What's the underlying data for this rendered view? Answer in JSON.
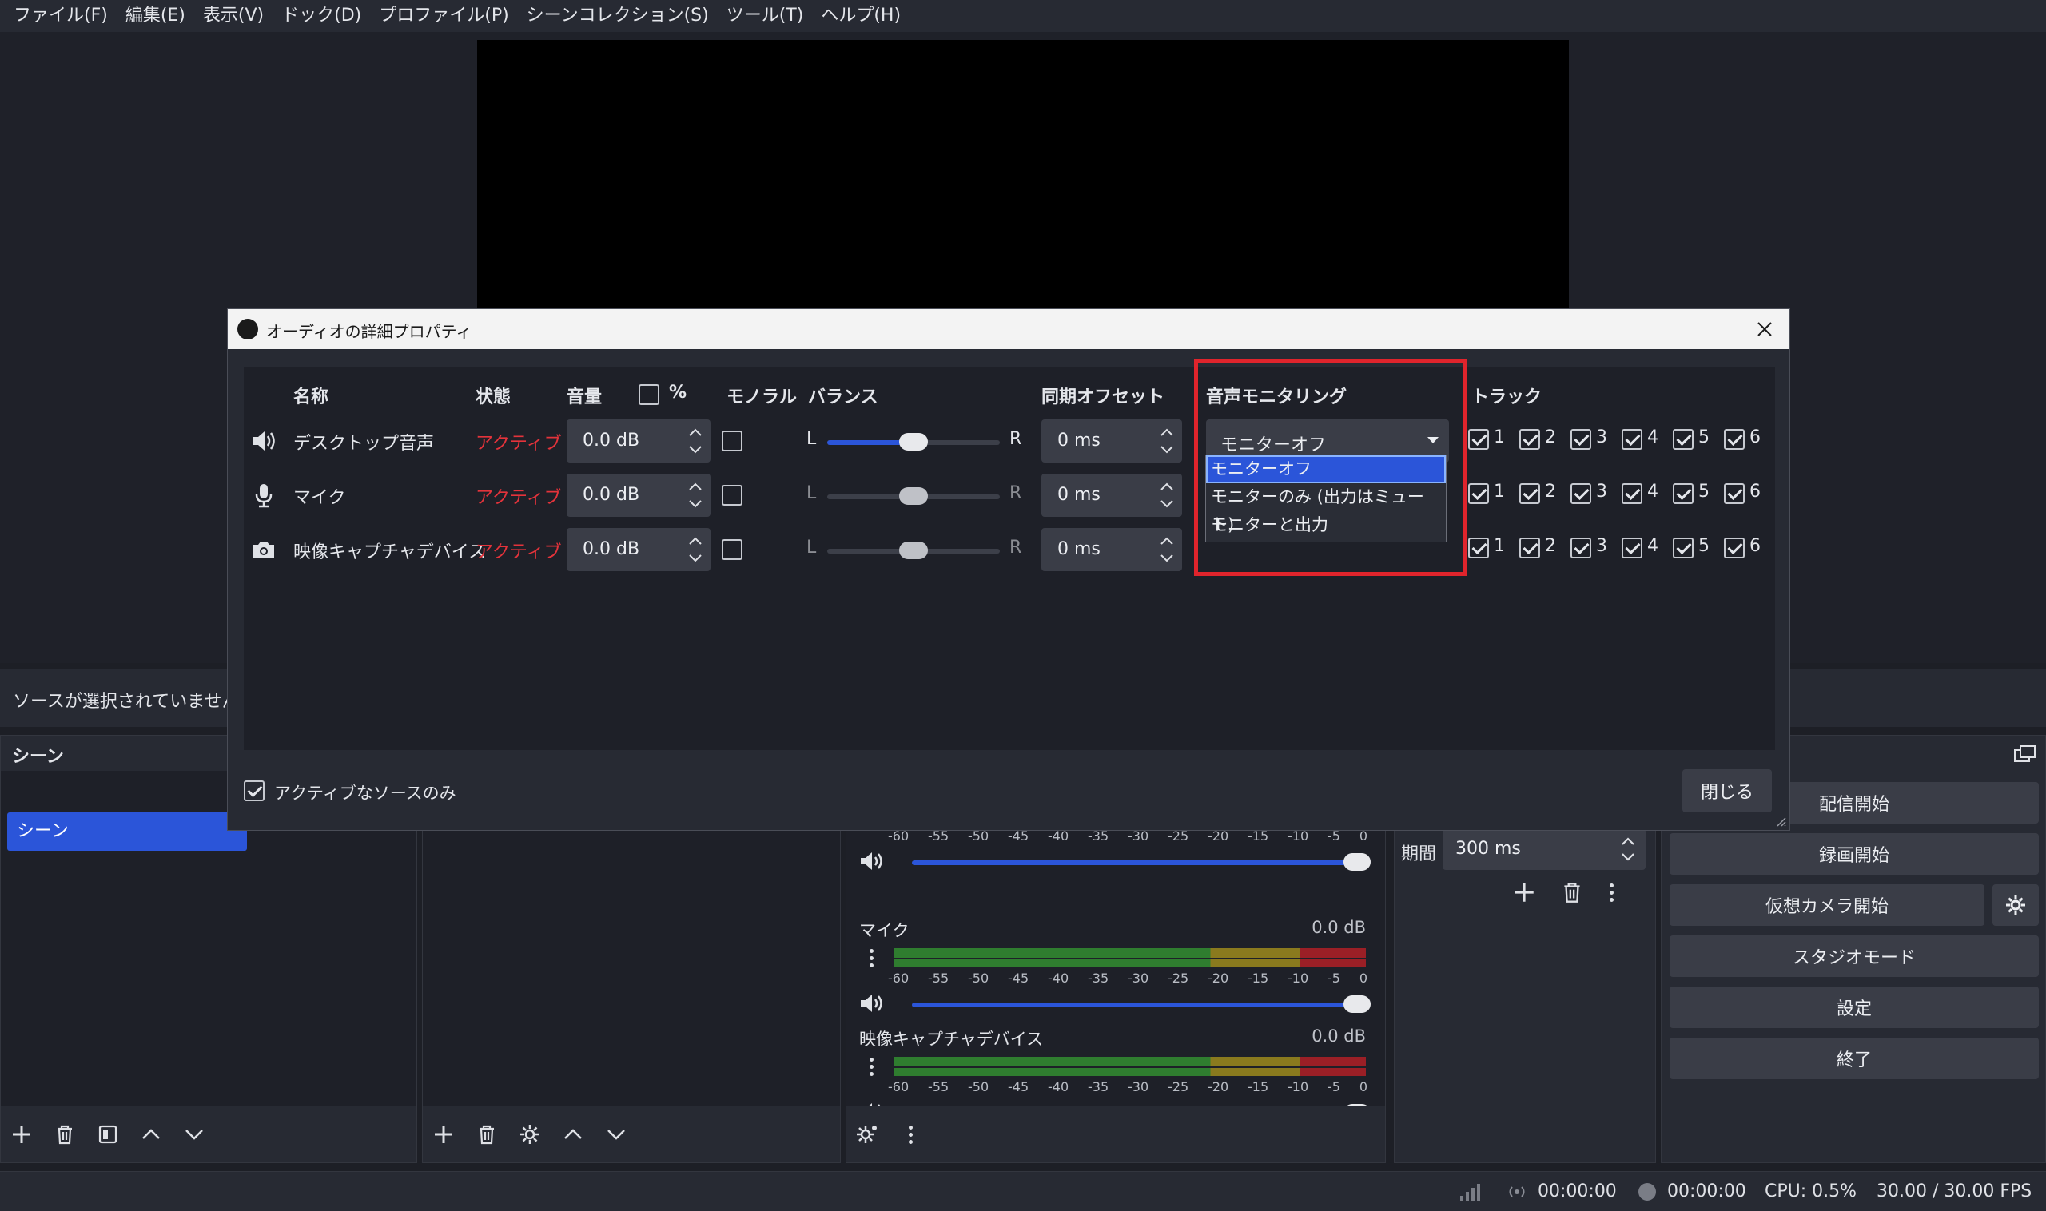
{
  "menu": [
    "ファイル(F)",
    "編集(E)",
    "表示(V)",
    "ドック(D)",
    "プロファイル(P)",
    "シーンコレクション(S)",
    "ツール(T)",
    "ヘルプ(H)"
  ],
  "source_bar": {
    "text": "ソースが選択されていません"
  },
  "scene_dock": {
    "title": "シーン",
    "scene_item": "シーン"
  },
  "mixer": {
    "ticks": [
      "-60",
      "-55",
      "-50",
      "-45",
      "-40",
      "-35",
      "-30",
      "-25",
      "-20",
      "-15",
      "-10",
      "-5",
      "0"
    ],
    "channels": [
      {
        "name": "マイク",
        "db": "0.0 dB"
      },
      {
        "name": "映像キャプチャデバイス",
        "db": "0.0 dB"
      }
    ]
  },
  "transition": {
    "period_label": "期間",
    "period_value": "300 ms"
  },
  "controls": {
    "start_stream": "配信開始",
    "start_record": "録画開始",
    "start_virtual_cam": "仮想カメラ開始",
    "studio_mode": "スタジオモード",
    "settings": "設定",
    "exit": "終了"
  },
  "status": {
    "stream_time": "00:00:00",
    "record_time": "00:00:00",
    "cpu": "CPU: 0.5%",
    "fps": "30.00 / 30.00 FPS"
  },
  "dialog": {
    "title": "オーディオの詳細プロパティ",
    "headers": {
      "name": "名称",
      "status": "状態",
      "volume": "音量",
      "percent": "%",
      "mono": "モノラル",
      "balance": "バランス",
      "sync_offset": "同期オフセット",
      "monitoring": "音声モニタリング",
      "tracks": "トラック"
    },
    "balance_left": "L",
    "balance_right": "R",
    "rows": [
      {
        "name": "デスクトップ音声",
        "status": "アクティブ",
        "volume": "0.0 dB",
        "sync": "0 ms",
        "monitoring": "モニターオフ",
        "balance": 0.5
      },
      {
        "name": "マイク",
        "status": "アクティブ",
        "volume": "0.0 dB",
        "sync": "0 ms",
        "monitoring": "モニターオフ",
        "balance": 0.5
      },
      {
        "name": "映像キャプチャデバイス",
        "status": "アクティブ",
        "volume": "0.0 dB",
        "sync": "0 ms",
        "monitoring": "モニターオフ",
        "balance": 0.5
      }
    ],
    "track_numbers": [
      "1",
      "2",
      "3",
      "4",
      "5",
      "6"
    ],
    "dropdown_options": [
      "モニターオフ",
      "モニターのみ (出力はミュート)",
      "モニターと出力"
    ],
    "dropdown_selected": "モニターオフ",
    "active_only_label": "アクティブなソースのみ",
    "close_button": "閉じる"
  },
  "colors": {
    "accent": "#2b55d9",
    "status_active": "#e4333b",
    "highlight": "#e0242c"
  }
}
